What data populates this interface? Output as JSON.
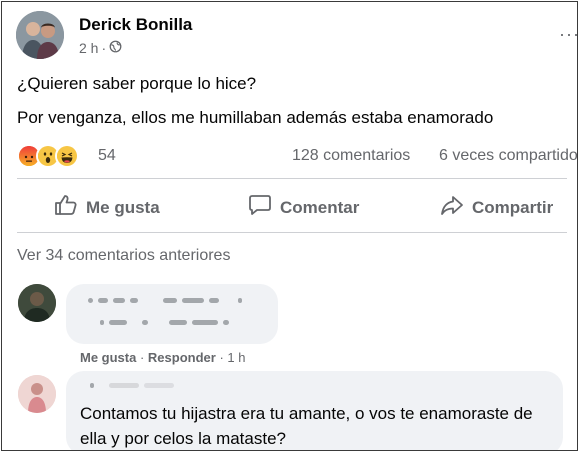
{
  "post": {
    "author": "Derick Bonilla",
    "time": "2 h",
    "privacy_icon": "globe-icon",
    "text_line1": "¿Quieren saber porque lo hice?",
    "text_line2": "Por venganza, ellos me humillaban además estaba enamorado",
    "reactions": {
      "icons": [
        "angry-reaction-icon",
        "wow-reaction-icon",
        "haha-reaction-icon"
      ],
      "count": "54"
    },
    "comments_count": "128 comentarios",
    "shares_count": "6 veces compartido"
  },
  "actions": {
    "like": "Me gusta",
    "comment": "Comentar",
    "share": "Compartir"
  },
  "comments": {
    "view_previous": "Ver 34 comentarios anteriores",
    "items": [
      {
        "meta_like": "Me gusta",
        "meta_reply": "Responder",
        "meta_time": "1 h"
      },
      {
        "text": "Contamos tu hijastra era tu amante, o vos te enamoraste de ella y por celos la mataste?"
      }
    ]
  },
  "colors": {
    "secondary_text": "#65676b",
    "bubble_bg": "#f0f2f5",
    "divider": "#ced0d4"
  }
}
